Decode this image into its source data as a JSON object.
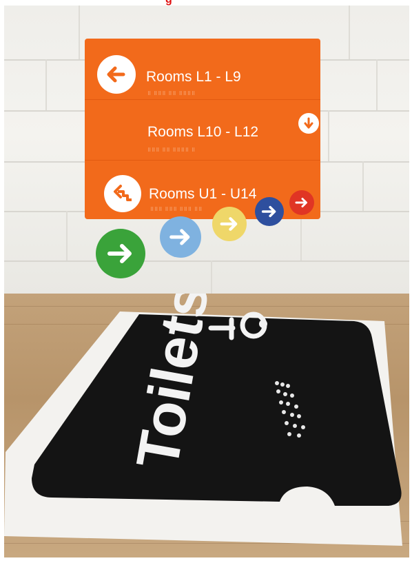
{
  "top_caption": "g",
  "wall_sign": {
    "rows": [
      {
        "label": "Rooms L1 - L9"
      },
      {
        "label": "Rooms L10 - L12"
      },
      {
        "label": "Rooms U1 - U14"
      }
    ],
    "panel_color": "#f26a1b",
    "circle_colors": [
      "#3aa33a",
      "#7fb2e0",
      "#efd769",
      "#2e4f9e",
      "#e03524"
    ]
  },
  "toilet_sign": {
    "text": "Toilets",
    "icon": "wheelchair-icon",
    "plate_color": "#141414",
    "backing_color": "#f3f2ef"
  }
}
